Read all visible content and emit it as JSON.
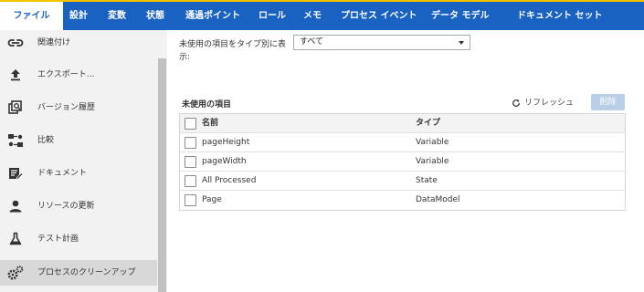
{
  "tabs": [
    {
      "label": "ファイル",
      "active": true
    },
    {
      "label": "設計"
    },
    {
      "label": "変数"
    },
    {
      "label": "状態"
    },
    {
      "label": "通過ポイント"
    },
    {
      "label": "ロール"
    },
    {
      "label": "メモ"
    },
    {
      "label": "プロセス イベント"
    },
    {
      "label": "データ モデル"
    },
    {
      "label": "ドキュメント セット"
    }
  ],
  "sidebar": {
    "items": [
      {
        "label": "関連付け",
        "icon": "link-icon"
      },
      {
        "label": "エクスポート...",
        "icon": "upload-icon"
      },
      {
        "label": "バージョン履歴",
        "icon": "version-history-icon"
      },
      {
        "label": "比較",
        "icon": "compare-icon"
      },
      {
        "label": "ドキュメント",
        "icon": "document-edit-icon"
      },
      {
        "label": "リソースの更新",
        "icon": "person-icon"
      },
      {
        "label": "テスト計画",
        "icon": "flask-icon"
      },
      {
        "label": "プロセスのクリーンアップ",
        "icon": "gears-icon",
        "active": true
      }
    ]
  },
  "filter": {
    "label": "未使用の項目をタイプ別に表示:",
    "selected": "すべて"
  },
  "section": {
    "title": "未使用の項目",
    "refresh_label": "リフレッシュ",
    "delete_label": "削除"
  },
  "table": {
    "columns": [
      "名前",
      "タイプ"
    ],
    "rows": [
      {
        "name": "pageHeight",
        "type": "Variable"
      },
      {
        "name": "pageWidth",
        "type": "Variable"
      },
      {
        "name": "All Processed",
        "type": "State"
      },
      {
        "name": "Page",
        "type": "DataModel"
      }
    ]
  },
  "colors": {
    "topbar": "#1a62c2",
    "accent_line": "#f5c400",
    "delete_disabled": "#b9cfe8"
  }
}
